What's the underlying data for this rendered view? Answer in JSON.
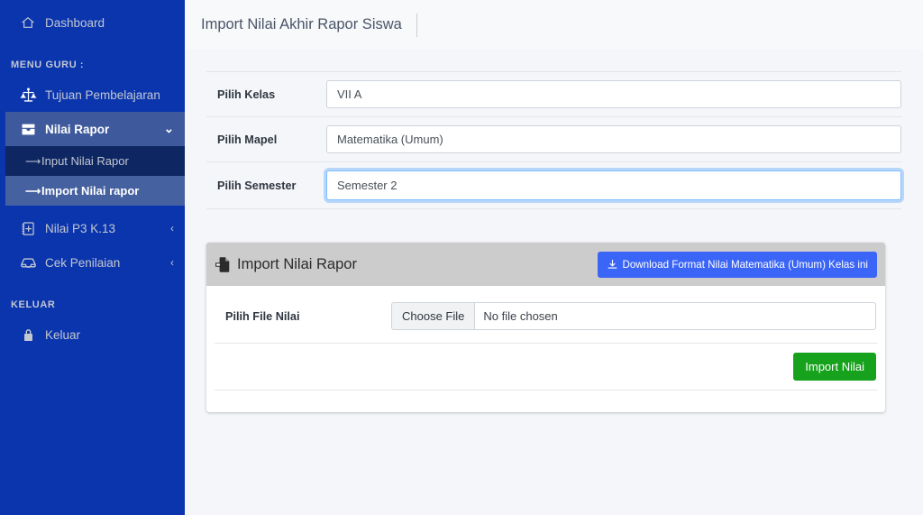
{
  "sidebar": {
    "dashboard": {
      "label": "Dashboard",
      "icon": "home-icon"
    },
    "section_menu_label": "MENU GURU :",
    "items": [
      {
        "label": "Tujuan Pembelajaran",
        "icon": "balance-scale-icon",
        "state": "normal",
        "caret": ""
      },
      {
        "label": "Nilai Rapor",
        "icon": "inbox-icon",
        "state": "active",
        "caret": "⌄"
      },
      {
        "label": "Nilai P3 K.13",
        "icon": "book-plus-icon",
        "state": "normal",
        "caret": "‹"
      },
      {
        "label": "Cek Penilaian",
        "icon": "archive-icon",
        "state": "normal",
        "caret": "‹"
      }
    ],
    "submenu": [
      {
        "label": "Input Nilai Rapor",
        "icon": "arrow-right-icon",
        "state": "normal"
      },
      {
        "label": "Import Nilai rapor",
        "icon": "arrow-right-icon",
        "state": "selected"
      }
    ],
    "section_logout_label": "KELUAR",
    "logout": {
      "label": "Keluar",
      "icon": "lock-icon"
    },
    "colors": {
      "base": "#0b35ad",
      "active": "#3f5a9c",
      "submenu_bg": "#0e2763",
      "submenu_selected": "#45619f"
    }
  },
  "topbar": {
    "title": "Import Nilai Akhir Rapor Siswa"
  },
  "form": {
    "rows": [
      {
        "label": "Pilih Kelas",
        "value": "VII A",
        "focused": false
      },
      {
        "label": "Pilih Mapel",
        "value": "Matematika (Umum)",
        "focused": false
      },
      {
        "label": "Pilih Semester",
        "value": "Semester 2",
        "focused": true
      }
    ]
  },
  "card": {
    "title": "Import Nilai Rapor",
    "title_icon": "file-import-icon",
    "download_button": {
      "label": "Download Format Nilai Matematika (Umum) Kelas ini",
      "icon": "download-icon",
      "color": "#3b65f6"
    },
    "file_row": {
      "label": "Pilih File Nilai",
      "choose_button": "Choose File",
      "file_name": "No file chosen"
    },
    "submit_button": {
      "label": "Import Nilai",
      "color": "#17a21d"
    }
  }
}
